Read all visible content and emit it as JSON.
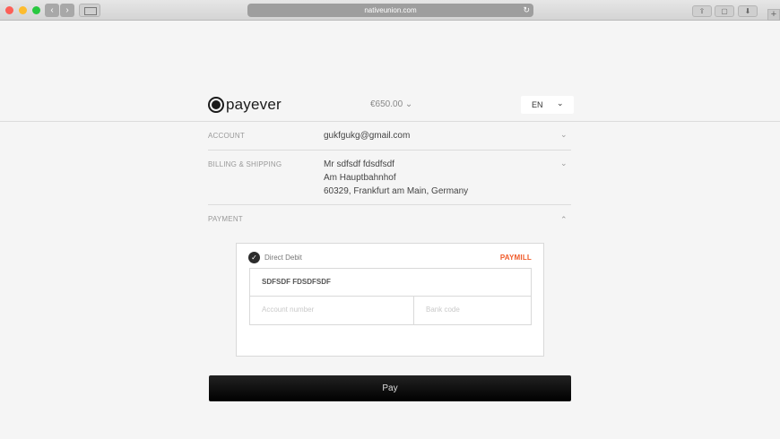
{
  "browser": {
    "url": "nativeunion.com",
    "reload_glyph": "↻",
    "back_glyph": "‹",
    "forward_glyph": "›",
    "new_tab_glyph": "+"
  },
  "header": {
    "logo_text": "payever",
    "amount": "€650.00 ⌄",
    "language": "EN",
    "language_chevron": "⌄"
  },
  "sections": {
    "account": {
      "label": "ACCOUNT",
      "value": "gukfgukg@gmail.com",
      "chevron": "⌄"
    },
    "billing": {
      "label": "BILLING & SHIPPING",
      "lines": [
        "Mr sdfsdf fdsdfsdf",
        "Am Hauptbahnhof",
        "60329, Frankfurt am Main, Germany"
      ],
      "chevron": "⌄"
    },
    "payment": {
      "label": "PAYMENT",
      "chevron": "⌃"
    }
  },
  "payment_card": {
    "check_glyph": "✓",
    "method": "Direct Debit",
    "provider": "PAYMILL",
    "account_holder": "SDFSDF FDSDFSDF",
    "account_number_placeholder": "Account number",
    "bank_code_placeholder": "Bank code"
  },
  "pay_button": {
    "label": "Pay"
  },
  "colors": {
    "provider_brand": "#f05a28",
    "pay_button": "#111111"
  }
}
